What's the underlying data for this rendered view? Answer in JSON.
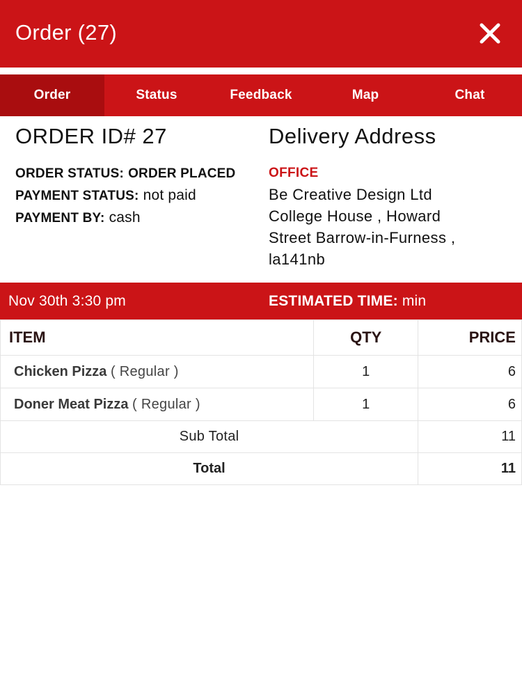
{
  "header": {
    "title": "Order (27)"
  },
  "tabs": [
    {
      "label": "Order",
      "active": true
    },
    {
      "label": "Status",
      "active": false
    },
    {
      "label": "Feedback",
      "active": false
    },
    {
      "label": "Map",
      "active": false
    },
    {
      "label": "Chat",
      "active": false
    }
  ],
  "order": {
    "id_title": "ORDER ID# 27",
    "order_status_label": "ORDER STATUS:",
    "order_status_value": "ORDER PLACED",
    "payment_status_label": "PAYMENT STATUS:",
    "payment_status_value": "not paid",
    "payment_by_label": "PAYMENT BY:",
    "payment_by_value": "cash"
  },
  "delivery": {
    "title": "Delivery Address",
    "type": "OFFICE",
    "lines": [
      "Be Creative Design Ltd",
      "College House , Howard",
      "Street Barrow-in-Furness ,",
      "la141nb"
    ]
  },
  "timebar": {
    "datetime": "Nov 30th 3:30 pm",
    "estimated_label": "ESTIMATED TIME:",
    "estimated_value": "min"
  },
  "table": {
    "headers": {
      "item": "ITEM",
      "qty": "QTY",
      "price": "PRICE"
    },
    "rows": [
      {
        "name": "Chicken Pizza",
        "size": "( Regular )",
        "qty": "1",
        "price": "6"
      },
      {
        "name": "Doner Meat Pizza",
        "size": "( Regular )",
        "qty": "1",
        "price": "6"
      }
    ],
    "subtotal_label": "Sub Total",
    "subtotal_value": "11",
    "total_label": "Total",
    "total_value": "11"
  },
  "colors": {
    "brand_red": "#cb1417",
    "active_tab": "#a90d0f"
  },
  "icons": {
    "close": "close-icon"
  }
}
